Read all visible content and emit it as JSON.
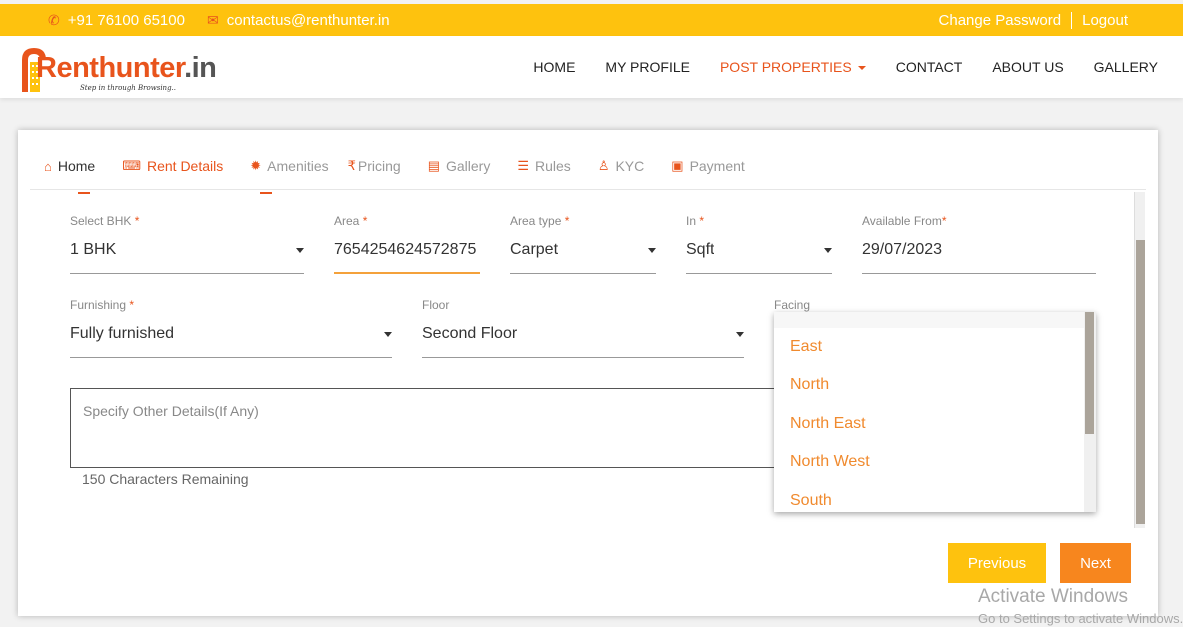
{
  "topbar": {
    "phone": "+91 76100 65100",
    "email": "contactus@renthunter.in",
    "change_password": "Change Password",
    "logout": "Logout",
    "bg_color": "#fec20e"
  },
  "brand": {
    "name_main": "Renthunter",
    "name_suffix": ".in",
    "tagline": "Step in through Browsing.."
  },
  "nav": {
    "home": "HOME",
    "my_profile": "MY PROFILE",
    "post_properties": "POST PROPERTIES",
    "contact": "CONTACT",
    "about_us": "ABOUT US",
    "gallery": "GALLERY"
  },
  "tabs": {
    "home": "Home",
    "rent_details": "Rent Details",
    "amenities": "Amenities",
    "pricing": "Pricing",
    "gallery": "Gallery",
    "rules": "Rules",
    "kyc": "KYC",
    "payment": "Payment",
    "accent_color": "#e8541c"
  },
  "form": {
    "bhk": {
      "label": "Select BHK",
      "value": "1 BHK"
    },
    "area": {
      "label": "Area",
      "value": "7654254624572875"
    },
    "area_type": {
      "label": "Area type",
      "value": "Carpet"
    },
    "unit": {
      "label": "In",
      "value": "Sqft"
    },
    "available_from": {
      "label": "Available From",
      "value": "29/07/2023"
    },
    "furnishing": {
      "label": "Furnishing",
      "value": "Fully furnished"
    },
    "floor": {
      "label": "Floor",
      "value": "Second Floor"
    },
    "facing": {
      "label": "Facing"
    },
    "required_mark": "*",
    "other_details_placeholder": "Specify Other Details(If Any)",
    "chars_remaining": "150 Characters Remaining"
  },
  "facing_options": [
    "East",
    "North",
    "North East",
    "North West",
    "South"
  ],
  "buttons": {
    "previous": "Previous",
    "next": "Next"
  },
  "watermark": {
    "line1": "Activate Windows",
    "line2": "Go to Settings to activate Windows."
  }
}
